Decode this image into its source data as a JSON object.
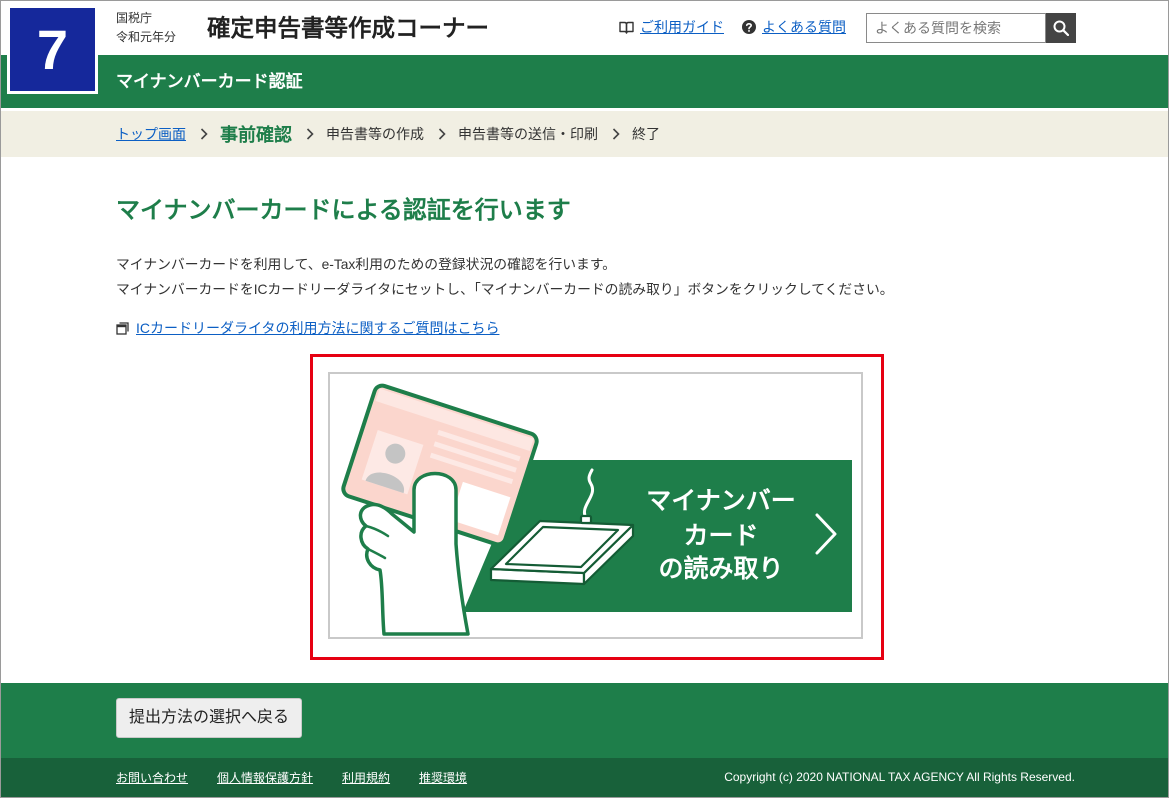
{
  "header": {
    "badge_number": "7",
    "org": "国税庁",
    "year": "令和元年分",
    "title": "確定申告書等作成コーナー",
    "guide_link": "ご利用ガイド",
    "faq_link": "よくある質問",
    "search_placeholder": "よくある質問を検索",
    "search_value": ""
  },
  "section_bar": {
    "title": "マイナンバーカード認証"
  },
  "breadcrumb": {
    "top_link": "トップ画面",
    "current_step": "事前確認",
    "next_steps": [
      "申告書等の作成",
      "申告書等の送信・印刷",
      "終了"
    ]
  },
  "main": {
    "heading": "マイナンバーカードによる認証を行います",
    "paragraphs": [
      "マイナンバーカードを利用して、e-Tax利用のための登録状況の確認を行います。",
      "マイナンバーカードをICカードリーダライタにセットし、「マイナンバーカードの読み取り」ボタンをクリックしてください。"
    ],
    "help_link": "ICカードリーダライタの利用方法に関するご質問はこちら",
    "read_button": {
      "line1": "マイナンバー",
      "line2": "カード",
      "line3": "の読み取り"
    }
  },
  "footer": {
    "back_button": "提出方法の選択へ戻る",
    "links": [
      "お問い合わせ",
      "個人情報保護方針",
      "利用規約",
      "推奨環境"
    ],
    "copyright": "Copyright (c) 2020 NATIONAL TAX AGENCY All Rights Reserved."
  },
  "icons": {
    "guide": "book-icon",
    "faq": "question-circle-icon",
    "search": "search-icon",
    "help_link": "new-window-icon",
    "breadcrumb_separator": "chevron-right-icon",
    "read_button_arrow": "chevron-right-icon",
    "read_button_illustration": [
      "my-number-card-icon",
      "hand-icon",
      "card-reader-icon"
    ]
  },
  "colors": {
    "brand_green": "#1e7e4a",
    "footer_dark": "#18613a",
    "badge_blue": "#15289b",
    "highlight_red": "#e60012",
    "link_blue": "#0c5fc4",
    "breadcrumb_bg": "#f1efe3"
  }
}
